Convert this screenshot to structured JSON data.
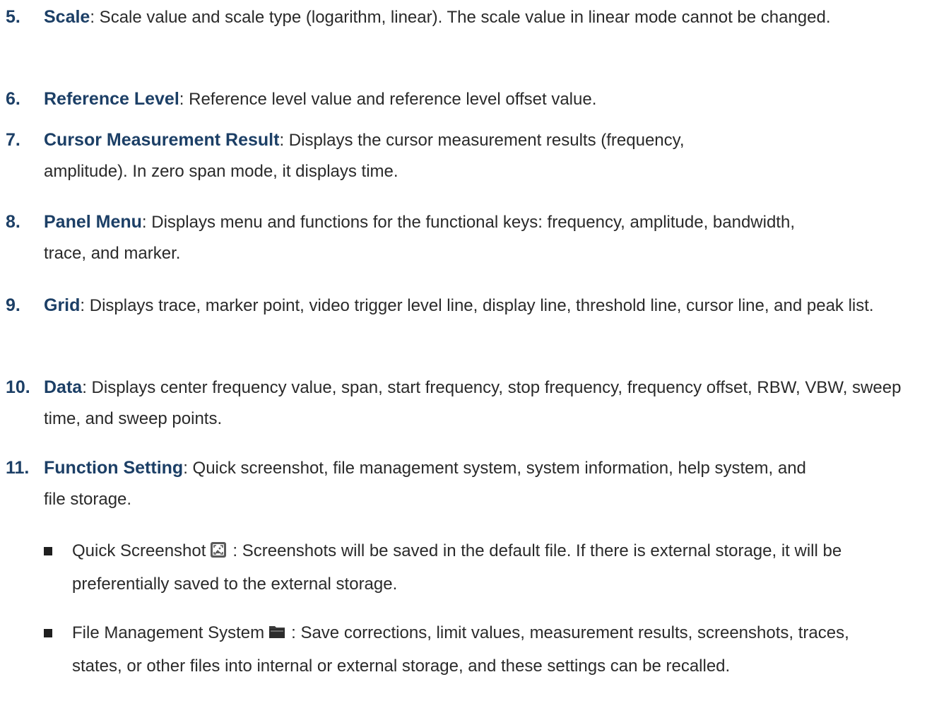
{
  "items": [
    {
      "number": "5.",
      "term": "Scale",
      "text": ": Scale value and scale type (logarithm, linear). The scale value in linear mode cannot be changed."
    },
    {
      "number": "6.",
      "term": "Reference Level",
      "text": ": Reference level value and reference level offset value."
    },
    {
      "number": "7.",
      "term": "Cursor Measurement Result",
      "text": ": Displays the cursor measurement results (frequency, amplitude). In zero span mode, it displays time."
    },
    {
      "number": "8.",
      "term": "Panel Menu",
      "text": ": Displays menu and functions for the functional keys: frequency, amplitude, bandwidth, trace, and marker."
    },
    {
      "number": "9.",
      "term": "Grid",
      "text": ": Displays trace, marker point, video trigger level line, display line, threshold line, cursor line, and peak list."
    },
    {
      "number": "10.",
      "term": "Data",
      "text": ": Displays center frequency value, span, start frequency, stop frequency, frequency offset, RBW, VBW, sweep time, and sweep points."
    },
    {
      "number": "11.",
      "term": "Function Setting",
      "text": ": Quick screenshot, file management system, system information, help system, and file storage."
    }
  ],
  "subitems": [
    {
      "label": "Quick Screenshot",
      "icon": "screenshot-icon",
      "text": ": Screenshots will be saved in the default file. If there is external storage, it will be preferentially saved to the external storage."
    },
    {
      "label": "File Management System",
      "icon": "folder-icon",
      "text": ": Save corrections, limit values, measurement results, screenshots, traces, states, or other files into internal or external storage, and these settings can be recalled."
    }
  ]
}
